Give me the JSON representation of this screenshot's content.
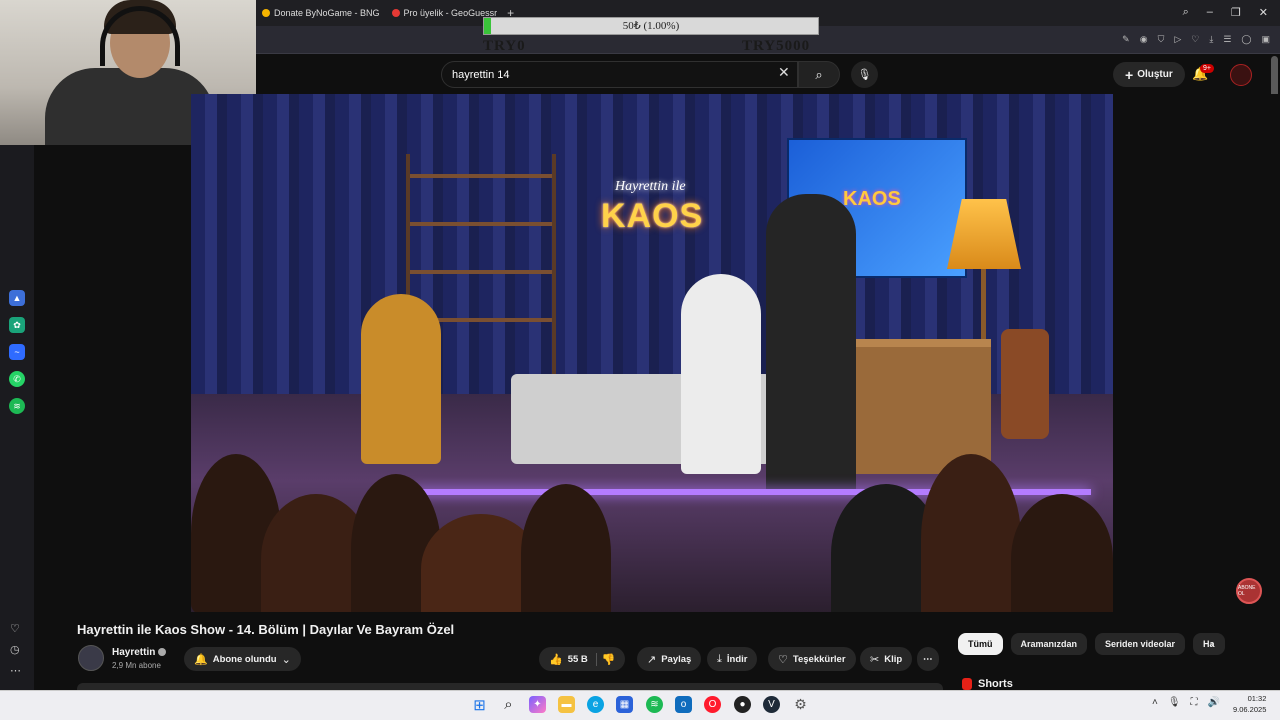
{
  "browser": {
    "tabs": [
      {
        "label": "Donate ByNoGame - BNG"
      },
      {
        "label": "Pro üyelik - GeoGuessr"
      }
    ],
    "new_tab": "+"
  },
  "donation_overlay": {
    "progress_text": "50₺ (1.00%)",
    "progress_fraction": 0.01,
    "min_label": "TRY0",
    "max_label": "TRY5000"
  },
  "youtube": {
    "search": {
      "value": "hayrettin 14"
    },
    "create_label": "Oluştur",
    "notification_count": "9+",
    "video": {
      "title": "Hayrettin ile Kaos Show - 14. Bölüm | Dayılar Ve Bayram Özel",
      "channel_name": "Hayrettin",
      "subscribers": "2,9 Mn abone",
      "subscribe_label": "Abone olundu",
      "like_count": "55 B",
      "share_label": "Paylaş",
      "download_label": "İndir",
      "thanks_label": "Teşekkürler",
      "clip_label": "Klip",
      "more_label": "⋯"
    },
    "scene": {
      "neon_small": "Hayrettin ile",
      "neon_big": "KAOS",
      "screen_text": "KAOS"
    },
    "channel_badge": "ABONE OL",
    "chips": [
      {
        "label": "Tümü",
        "active": true
      },
      {
        "label": "Aramanızdan"
      },
      {
        "label": "Seriden videolar"
      },
      {
        "label": "Ha"
      }
    ],
    "shorts_label": "Shorts"
  },
  "taskbar": {
    "time": "01:32",
    "date": "9.06.2025"
  },
  "colors": {
    "background": "#0f0f0f",
    "progress_fill": "#3ac43a",
    "youtube_red": "#e62117"
  }
}
